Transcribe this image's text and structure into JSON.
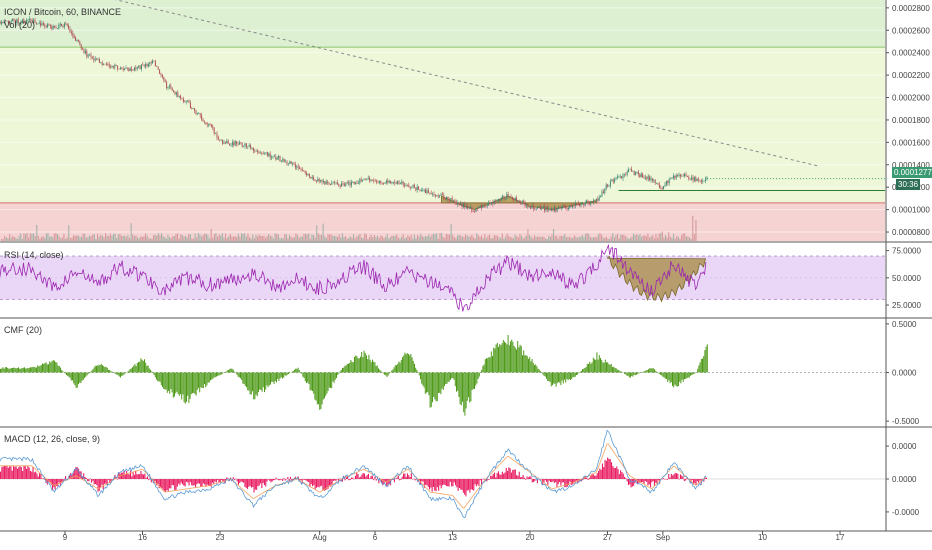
{
  "symbol_title": "ICON / Bitcoin, 60, BINANCE",
  "vol_title": "Vol (20)",
  "rsi_title": "RSI (14, close)",
  "cmf_title": "CMF (20)",
  "macd_title": "MACD (12, 26, close, 9)",
  "price_label": "0.0001277",
  "countdown_label": "30:36",
  "colors": {
    "candle_up": "#3e8a74",
    "candle_down": "#b05357",
    "green_zone": "#ddf0d2",
    "yellow_zone": "#eef7d8",
    "red_zone": "#f6d3d3",
    "rsi_line": "#9c27b0",
    "rsi_band": "#ead7f7",
    "cmf_bar": "#4f9a19",
    "macd_line": "#5b9bd5",
    "signal_line": "#f4a460",
    "hist": "#e91e63",
    "pattern_fill": "#a6883f",
    "price_badge": "#3a9b73",
    "countdown_badge": "#2d6e56"
  },
  "chart_data": [
    {
      "type": "line",
      "name": "price",
      "x": [
        "Jul 6",
        "Jul 8",
        "Jul 9",
        "Jul 11",
        "Jul 13",
        "Jul 15",
        "Jul 16",
        "Jul 17",
        "Jul 18",
        "Jul 20",
        "Jul 21",
        "Jul 22",
        "Jul 23",
        "Jul 25",
        "Jul 28",
        "Jul 30",
        "Aug 1",
        "Aug 3",
        "Aug 5",
        "Aug 6",
        "Aug 8",
        "Aug 10",
        "Aug 12",
        "Aug 14",
        "Aug 15",
        "Aug 17",
        "Aug 18",
        "Aug 20",
        "Aug 22",
        "Aug 24",
        "Aug 26",
        "Aug 27",
        "Aug 29",
        "Aug 30",
        "Aug 31",
        "Sep 1",
        "Sep 2",
        "Sep 3",
        "Sep 4",
        "Sep 5"
      ],
      "values": [
        0.000268,
        0.000262,
        0.000265,
        0.000238,
        0.000228,
        0.000224,
        0.000228,
        0.000232,
        0.000212,
        0.000196,
        0.000185,
        0.000176,
        0.000161,
        0.000158,
        0.000147,
        0.000138,
        0.000125,
        0.000122,
        0.000127,
        0.000125,
        0.000125,
        0.000118,
        0.000112,
        0.000103,
        0.0001,
        0.000108,
        0.000112,
        0.000103,
        0.0001,
        0.000104,
        0.000108,
        0.000122,
        0.000135,
        0.00013,
        0.000126,
        0.00012,
        0.00013,
        0.00013,
        0.000126,
        0.000128
      ],
      "y_ticks": [
        8e-05,
        0.0001,
        0.00012,
        0.00014,
        0.00016,
        0.00018,
        0.0002,
        0.00022,
        0.00024,
        0.00026,
        0.00028
      ],
      "y_tick_labels": [
        "0.0000800",
        "0.0001000",
        "0.0001200",
        "0.0001400",
        "0.0001600",
        "0.0001800",
        "0.0002000",
        "0.0002200",
        "0.0002400",
        "0.0002600",
        "0.0002800"
      ],
      "ylim": [
        7.2e-05,
        0.000287
      ],
      "horizontal_levels": [
        0.000245,
        0.000106,
        0.000117
      ],
      "trendline": {
        "from": [
          "Jul 6",
          0.000305
        ],
        "to": [
          "Sep 15",
          0.000139
        ]
      },
      "pattern": {
        "name": "rounded bottom",
        "from": "Aug 12",
        "to": "Aug 26"
      },
      "grid": true
    },
    {
      "type": "line",
      "name": "RSI (14, close)",
      "y_ticks": [
        25,
        50,
        75
      ],
      "y_tick_labels": [
        "25.0000",
        "50.0000",
        "75.0000"
      ],
      "ylim": [
        14,
        82
      ],
      "band": [
        30,
        70
      ],
      "x": [
        "Jul 6",
        "Jul 8",
        "Jul 10",
        "Jul 12",
        "Jul 14",
        "Jul 16",
        "Jul 18",
        "Jul 20",
        "Jul 22",
        "Jul 24",
        "Jul 26",
        "Jul 28",
        "Jul 30",
        "Aug 1",
        "Aug 3",
        "Aug 5",
        "Aug 7",
        "Aug 9",
        "Aug 11",
        "Aug 13",
        "Aug 14",
        "Aug 16",
        "Aug 18",
        "Aug 20",
        "Aug 22",
        "Aug 24",
        "Aug 26",
        "Aug 27",
        "Aug 29",
        "Aug 31",
        "Sep 2",
        "Sep 4",
        "Sep 5"
      ],
      "values": [
        58,
        40,
        55,
        45,
        60,
        52,
        38,
        50,
        44,
        48,
        55,
        42,
        48,
        40,
        50,
        60,
        42,
        55,
        45,
        38,
        20,
        48,
        65,
        52,
        55,
        42,
        62,
        80,
        55,
        38,
        62,
        42,
        62
      ],
      "pattern": {
        "name": "rounded bottom",
        "from": "Aug 27",
        "to": "Sep 5"
      },
      "grid": true
    },
    {
      "type": "bar",
      "name": "CMF (20)",
      "y_ticks": [
        -0.5,
        0,
        0.5
      ],
      "y_tick_labels": [
        "-0.5000",
        "0.0000",
        "0.5000"
      ],
      "ylim": [
        -0.55,
        0.55
      ],
      "x": [
        "Jul 6",
        "Jul 8",
        "Jul 10",
        "Jul 12",
        "Jul 14",
        "Jul 16",
        "Jul 18",
        "Jul 20",
        "Jul 22",
        "Jul 24",
        "Jul 26",
        "Jul 28",
        "Jul 30",
        "Aug 1",
        "Aug 3",
        "Aug 5",
        "Aug 7",
        "Aug 9",
        "Aug 11",
        "Aug 13",
        "Aug 14",
        "Aug 16",
        "Aug 18",
        "Aug 20",
        "Aug 22",
        "Aug 24",
        "Aug 26",
        "Aug 27",
        "Aug 29",
        "Aug 31",
        "Sep 2",
        "Sep 4",
        "Sep 5"
      ],
      "values": [
        0.05,
        0.12,
        -0.15,
        0.1,
        -0.05,
        0.15,
        -0.2,
        -0.3,
        -0.1,
        0.05,
        -0.25,
        -0.1,
        0.05,
        -0.35,
        0.05,
        0.22,
        -0.05,
        0.25,
        -0.35,
        -0.05,
        -0.45,
        0.15,
        0.38,
        0.15,
        -0.15,
        -0.05,
        0.18,
        0.1,
        -0.05,
        0.05,
        -0.15,
        0.0,
        0.32
      ],
      "grid": true
    },
    {
      "type": "line",
      "name": "MACD (12, 26, close, 9)",
      "y_ticks": [
        -1e-05,
        0,
        1e-05
      ],
      "y_tick_labels": [
        "-0.0000",
        "0.0000",
        "0.0000"
      ],
      "ylim": [
        -1.55e-05,
        1.55e-05
      ],
      "x": [
        "Jul 6",
        "Jul 8",
        "Jul 10",
        "Jul 12",
        "Jul 14",
        "Jul 16",
        "Jul 18",
        "Jul 20",
        "Jul 22",
        "Jul 24",
        "Jul 26",
        "Jul 28",
        "Jul 30",
        "Aug 1",
        "Aug 3",
        "Aug 5",
        "Aug 7",
        "Aug 9",
        "Aug 11",
        "Aug 13",
        "Aug 14",
        "Aug 16",
        "Aug 18",
        "Aug 20",
        "Aug 22",
        "Aug 24",
        "Aug 26",
        "Aug 27",
        "Aug 29",
        "Aug 31",
        "Sep 2",
        "Sep 4",
        "Sep 5"
      ],
      "series": [
        {
          "name": "MACD",
          "values": [
            6e-06,
            -4e-06,
            3e-06,
            -5e-06,
            2e-06,
            4e-06,
            -6e-06,
            -4e-06,
            -3e-06,
            0.0,
            -8e-06,
            -2e-06,
            0.0,
            -6e-06,
            0.0,
            4e-06,
            -2e-06,
            4e-06,
            -6e-06,
            -6e-06,
            -1.2e-05,
            0.0,
            9e-06,
            2e-06,
            -4e-06,
            -2e-06,
            3e-06,
            1.5e-05,
            0.0,
            -4e-06,
            5e-06,
            -3e-06,
            1e-06
          ]
        },
        {
          "name": "Signal",
          "values": [
            4e-06,
            -2e-06,
            1e-06,
            -3e-06,
            1e-06,
            3e-06,
            -4e-06,
            -3e-06,
            -2e-06,
            0.0,
            -6e-06,
            -2e-06,
            0.0,
            -4e-06,
            0.0,
            3e-06,
            -1e-06,
            3e-06,
            -4e-06,
            -5e-06,
            -9e-06,
            0.0,
            7e-06,
            2e-06,
            -3e-06,
            -1e-06,
            2e-06,
            1.1e-05,
            1e-06,
            -3e-06,
            4e-06,
            -2e-06,
            1e-06
          ]
        }
      ],
      "grid": true
    }
  ],
  "x_tick_labels": [
    "9",
    "16",
    "23",
    "Aug",
    "6",
    "13",
    "20",
    "27",
    "Sep",
    "10",
    "17"
  ],
  "x_tick_dates": [
    "Jul 9",
    "Jul 16",
    "Jul 23",
    "Aug 1",
    "Aug 6",
    "Aug 13",
    "Aug 20",
    "Aug 27",
    "Sep 1",
    "Sep 10",
    "Sep 17"
  ]
}
